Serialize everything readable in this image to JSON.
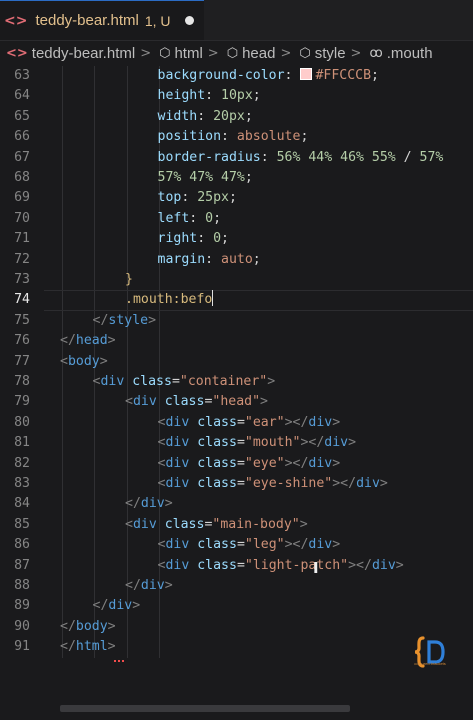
{
  "tab": {
    "icon": "html-file-icon",
    "filename": "teddy-bear.html",
    "status": "1, U"
  },
  "breadcrumb": {
    "items": [
      {
        "icon": "html-file-icon",
        "label": "teddy-bear.html"
      },
      {
        "icon": "symbol-element-icon",
        "label": "html"
      },
      {
        "icon": "symbol-element-icon",
        "label": "head"
      },
      {
        "icon": "symbol-element-icon",
        "label": "style"
      },
      {
        "icon": "symbol-selector-icon",
        "label": ".mouth"
      }
    ],
    "separator": ">"
  },
  "colors": {
    "swatch": "#FFCCCB",
    "accent_tab_border": "#2b6cc4"
  },
  "lines": [
    {
      "n": "63",
      "indent": 5,
      "parts": [
        [
          "prop",
          "background-color"
        ],
        [
          "punc",
          ": "
        ],
        [
          "swatch",
          ""
        ],
        [
          "val",
          "#FFCCCB"
        ],
        [
          "punc",
          ";"
        ]
      ]
    },
    {
      "n": "64",
      "indent": 5,
      "parts": [
        [
          "prop",
          "height"
        ],
        [
          "punc",
          ": "
        ],
        [
          "num",
          "10px"
        ],
        [
          "punc",
          ";"
        ]
      ]
    },
    {
      "n": "65",
      "indent": 5,
      "parts": [
        [
          "prop",
          "width"
        ],
        [
          "punc",
          ": "
        ],
        [
          "num",
          "20px"
        ],
        [
          "punc",
          ";"
        ]
      ]
    },
    {
      "n": "66",
      "indent": 5,
      "parts": [
        [
          "prop",
          "position"
        ],
        [
          "punc",
          ": "
        ],
        [
          "kw",
          "absolute"
        ],
        [
          "punc",
          ";"
        ]
      ]
    },
    {
      "n": "67",
      "indent": 5,
      "parts": [
        [
          "prop",
          "border-radius"
        ],
        [
          "punc",
          ": "
        ],
        [
          "num",
          "56% 44% 46% 55%"
        ],
        [
          "punc",
          " / "
        ],
        [
          "num",
          "57%"
        ]
      ]
    },
    {
      "n": "68",
      "indent": 5,
      "parts": [
        [
          "num",
          "57% 47% 47%"
        ],
        [
          "punc",
          ";"
        ]
      ]
    },
    {
      "n": "69",
      "indent": 5,
      "parts": [
        [
          "prop",
          "top"
        ],
        [
          "punc",
          ": "
        ],
        [
          "num",
          "25px"
        ],
        [
          "punc",
          ";"
        ]
      ]
    },
    {
      "n": "70",
      "indent": 5,
      "parts": [
        [
          "prop",
          "left"
        ],
        [
          "punc",
          ": "
        ],
        [
          "num",
          "0"
        ],
        [
          "punc",
          ";"
        ]
      ]
    },
    {
      "n": "71",
      "indent": 5,
      "parts": [
        [
          "prop",
          "right"
        ],
        [
          "punc",
          ": "
        ],
        [
          "num",
          "0"
        ],
        [
          "punc",
          ";"
        ]
      ]
    },
    {
      "n": "72",
      "indent": 5,
      "parts": [
        [
          "prop",
          "margin"
        ],
        [
          "punc",
          ": "
        ],
        [
          "kw",
          "auto"
        ],
        [
          "punc",
          ";"
        ]
      ]
    },
    {
      "n": "73",
      "indent": 4,
      "parts": [
        [
          "brace",
          "}"
        ]
      ]
    },
    {
      "n": "74",
      "indent": 4,
      "parts": [
        [
          "sel",
          ".mouth:befo"
        ],
        [
          "caret",
          ""
        ]
      ],
      "active": true
    },
    {
      "n": "75",
      "indent": 3,
      "parts": [
        [
          "bracket",
          "</"
        ],
        [
          "tag",
          "style"
        ],
        [
          "bracket",
          ">"
        ]
      ]
    },
    {
      "n": "76",
      "indent": 2,
      "parts": [
        [
          "bracket",
          "</"
        ],
        [
          "tag",
          "head"
        ],
        [
          "bracket",
          ">"
        ]
      ]
    },
    {
      "n": "77",
      "indent": 2,
      "parts": [
        [
          "bracket",
          "<"
        ],
        [
          "tag",
          "body"
        ],
        [
          "bracket",
          ">"
        ]
      ]
    },
    {
      "n": "78",
      "indent": 3,
      "parts": [
        [
          "bracket",
          "<"
        ],
        [
          "tag",
          "div"
        ],
        [
          "punc",
          " "
        ],
        [
          "attr",
          "class"
        ],
        [
          "punc",
          "="
        ],
        [
          "str",
          "\"container\""
        ],
        [
          "bracket",
          ">"
        ]
      ]
    },
    {
      "n": "79",
      "indent": 4,
      "parts": [
        [
          "bracket",
          "<"
        ],
        [
          "tag",
          "div"
        ],
        [
          "punc",
          " "
        ],
        [
          "attr",
          "class"
        ],
        [
          "punc",
          "="
        ],
        [
          "str",
          "\"head\""
        ],
        [
          "bracket",
          ">"
        ]
      ]
    },
    {
      "n": "80",
      "indent": 5,
      "parts": [
        [
          "bracket",
          "<"
        ],
        [
          "tag",
          "div"
        ],
        [
          "punc",
          " "
        ],
        [
          "attr",
          "class"
        ],
        [
          "punc",
          "="
        ],
        [
          "str",
          "\"ear\""
        ],
        [
          "bracket",
          "></"
        ],
        [
          "tag",
          "div"
        ],
        [
          "bracket",
          ">"
        ]
      ]
    },
    {
      "n": "81",
      "indent": 5,
      "parts": [
        [
          "bracket",
          "<"
        ],
        [
          "tag",
          "div"
        ],
        [
          "punc",
          " "
        ],
        [
          "attr",
          "class"
        ],
        [
          "punc",
          "="
        ],
        [
          "str",
          "\"mouth\""
        ],
        [
          "bracket",
          "></"
        ],
        [
          "tag",
          "div"
        ],
        [
          "bracket",
          ">"
        ]
      ]
    },
    {
      "n": "82",
      "indent": 5,
      "parts": [
        [
          "bracket",
          "<"
        ],
        [
          "tag",
          "div"
        ],
        [
          "punc",
          " "
        ],
        [
          "attr",
          "class"
        ],
        [
          "punc",
          "="
        ],
        [
          "str",
          "\"eye\""
        ],
        [
          "bracket",
          "></"
        ],
        [
          "tag",
          "div"
        ],
        [
          "bracket",
          ">"
        ]
      ]
    },
    {
      "n": "83",
      "indent": 5,
      "parts": [
        [
          "bracket",
          "<"
        ],
        [
          "tag",
          "div"
        ],
        [
          "punc",
          " "
        ],
        [
          "attr",
          "class"
        ],
        [
          "punc",
          "="
        ],
        [
          "str",
          "\"eye-shine\""
        ],
        [
          "bracket",
          "></"
        ],
        [
          "tag",
          "div"
        ],
        [
          "bracket",
          ">"
        ]
      ]
    },
    {
      "n": "84",
      "indent": 4,
      "parts": [
        [
          "bracket",
          "</"
        ],
        [
          "tag",
          "div"
        ],
        [
          "bracket",
          ">"
        ]
      ]
    },
    {
      "n": "85",
      "indent": 4,
      "parts": [
        [
          "bracket",
          "<"
        ],
        [
          "tag",
          "div"
        ],
        [
          "punc",
          " "
        ],
        [
          "attr",
          "class"
        ],
        [
          "punc",
          "="
        ],
        [
          "str",
          "\"main-body\""
        ],
        [
          "bracket",
          ">"
        ]
      ]
    },
    {
      "n": "86",
      "indent": 5,
      "parts": [
        [
          "bracket",
          "<"
        ],
        [
          "tag",
          "div"
        ],
        [
          "punc",
          " "
        ],
        [
          "attr",
          "class"
        ],
        [
          "punc",
          "="
        ],
        [
          "str",
          "\"leg\""
        ],
        [
          "bracket",
          "></"
        ],
        [
          "tag",
          "div"
        ],
        [
          "bracket",
          ">"
        ]
      ]
    },
    {
      "n": "87",
      "indent": 5,
      "parts": [
        [
          "bracket",
          "<"
        ],
        [
          "tag",
          "div"
        ],
        [
          "punc",
          " "
        ],
        [
          "attr",
          "class"
        ],
        [
          "punc",
          "="
        ],
        [
          "str",
          "\"light-patch\""
        ],
        [
          "bracket",
          "></"
        ],
        [
          "tag",
          "div"
        ],
        [
          "bracket",
          ">"
        ]
      ]
    },
    {
      "n": "88",
      "indent": 4,
      "parts": [
        [
          "bracket",
          "</"
        ],
        [
          "tag",
          "div"
        ],
        [
          "bracket",
          ">"
        ]
      ]
    },
    {
      "n": "89",
      "indent": 3,
      "parts": [
        [
          "bracket",
          "</"
        ],
        [
          "tag",
          "div"
        ],
        [
          "bracket",
          ">"
        ]
      ]
    },
    {
      "n": "90",
      "indent": 2,
      "parts": [
        [
          "bracket",
          "</"
        ],
        [
          "tag",
          "body"
        ],
        [
          "bracket",
          ">"
        ]
      ]
    },
    {
      "n": "91",
      "indent": 2,
      "parts": [
        [
          "bracket",
          "</"
        ],
        [
          "tag",
          "html"
        ],
        [
          "bracket",
          ">"
        ]
      ]
    }
  ],
  "logo": {
    "icon": "curly-brace-logo-icon",
    "caption": "coloured brackets"
  }
}
